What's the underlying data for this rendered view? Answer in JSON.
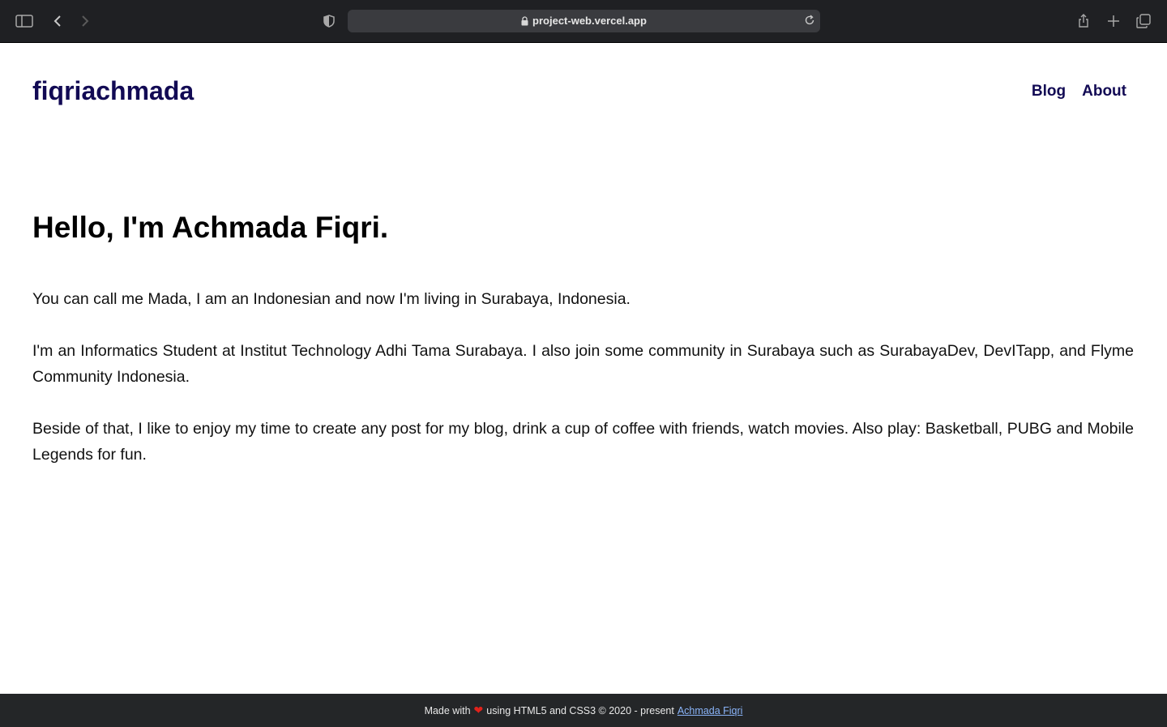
{
  "browser": {
    "url": "project-web.vercel.app"
  },
  "header": {
    "brand": "fiqriachmada",
    "nav": [
      {
        "label": "Blog"
      },
      {
        "label": "About"
      }
    ]
  },
  "main": {
    "title": "Hello, I'm Achmada Fiqri.",
    "paragraphs": [
      "You can call me Mada, I am an Indonesian and now I'm living in Surabaya, Indonesia.",
      "I'm an Informatics Student at Institut Technology Adhi Tama Surabaya. I also join some community in Surabaya such as SurabayaDev, DevITapp, and Flyme Community Indonesia.",
      "Beside of that, I like to enjoy my time to create any post for my blog, drink a cup of coffee with friends, watch movies. Also play: Basketball, PUBG and Mobile Legends for fun."
    ]
  },
  "footer": {
    "prefix": "Made with",
    "heart": "❤",
    "suffix": "using HTML5 and CSS3 © 2020 - present",
    "author": "Achmada Fiqri"
  },
  "colors": {
    "brand": "#120a54",
    "chrome_bg": "#1f2023",
    "footer_bg": "#242628",
    "footer_link": "#8ab4f8"
  },
  "icons": [
    "sidebar-icon",
    "back-icon",
    "forward-icon",
    "shield-icon",
    "lock-icon",
    "reload-icon",
    "share-icon",
    "new-tab-icon",
    "tabs-overview-icon",
    "heart-icon"
  ]
}
